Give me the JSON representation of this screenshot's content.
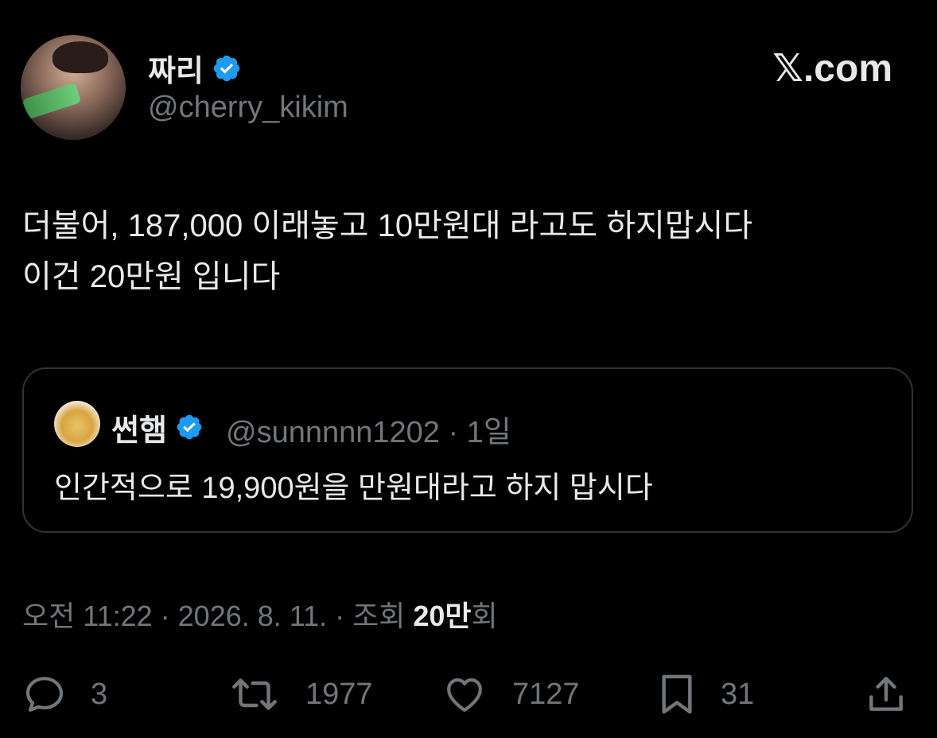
{
  "author": {
    "display_name": "짜리",
    "handle": "@cherry_kikim",
    "verified": true,
    "verified_color": "#1d9bf0",
    "avatar_icon": "profile-photo"
  },
  "brand": {
    "logo_text": ".com",
    "logo_mark": "𝕏"
  },
  "tweet": {
    "line1": "더불어, 187,000 이래놓고 10만원대 라고도 하지맙시다",
    "line2": "이건 20만원 입니다"
  },
  "quote": {
    "display_name": "썬햄",
    "verified": true,
    "meta": "@sunnnnn1202 · 1일",
    "text": "인간적으로 19,900원을 만원대라고 하지 맙시다"
  },
  "timestamp": {
    "prefix": "오전 11:22 · 2026. 8. 11. · 조회 ",
    "views": "20만",
    "suffix": "회"
  },
  "actions": {
    "replies": "3",
    "reposts": "1977",
    "likes": "7127",
    "bookmarks": "31"
  },
  "colors": {
    "background": "#000000",
    "text": "#e7e9ea",
    "muted": "#71767b",
    "border": "#2f3336"
  }
}
